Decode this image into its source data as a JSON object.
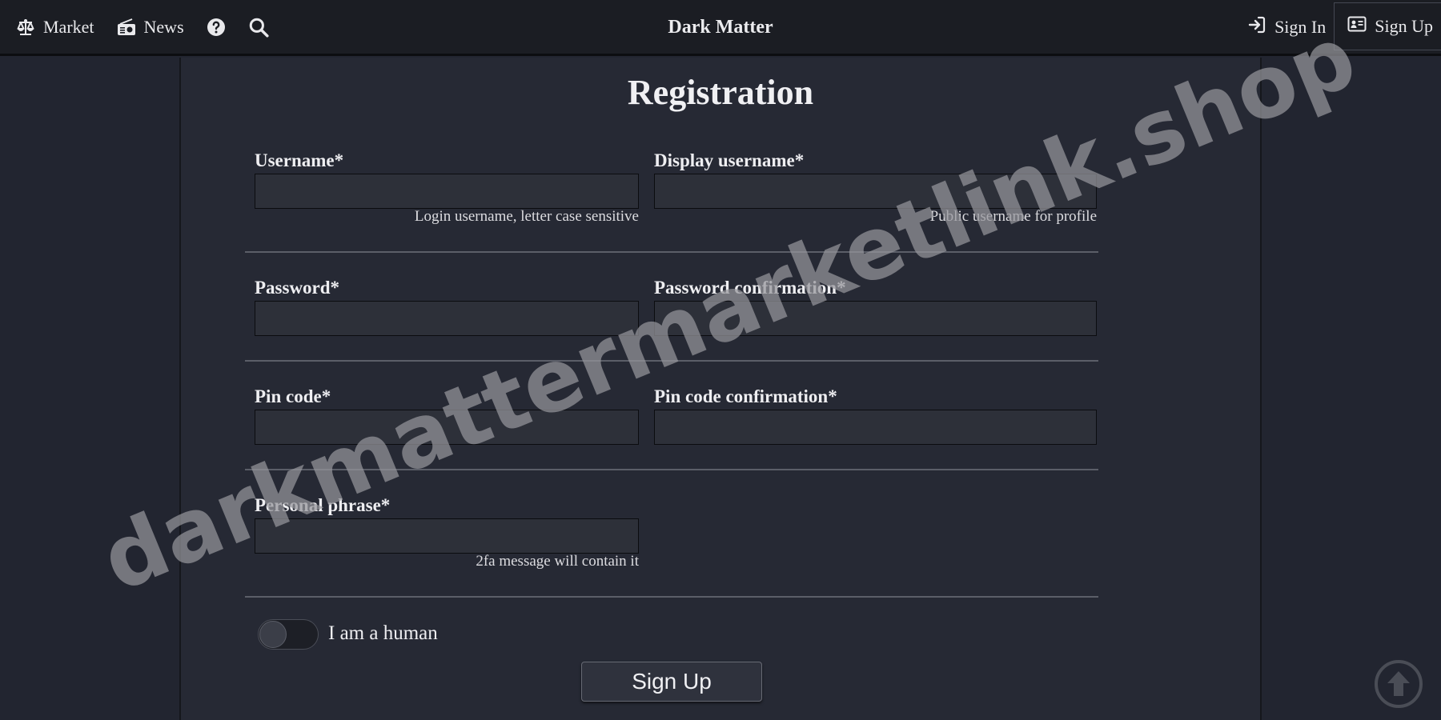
{
  "nav": {
    "market": "Market",
    "news": "News",
    "brand": "Dark Matter",
    "sign_in": "Sign In",
    "sign_up": "Sign Up"
  },
  "form": {
    "title": "Registration",
    "username_label": "Username*",
    "username_hint": "Login username, letter case sensitive",
    "display_label": "Display username*",
    "display_hint": "Public username for profile",
    "password_label": "Password*",
    "password_confirm_label": "Password confirmation*",
    "pin_label": "Pin code*",
    "pin_confirm_label": "Pin code confirmation*",
    "phrase_label": "Personal phrase*",
    "phrase_hint": "2fa message will contain it",
    "human_label": "I am a human",
    "submit_label": "Sign Up"
  },
  "watermark": "darkmattermarketlink.shop",
  "colors": {
    "background": "#222530",
    "panel": "#262934",
    "topbar": "#1b1d23",
    "field": "#2d3039"
  }
}
